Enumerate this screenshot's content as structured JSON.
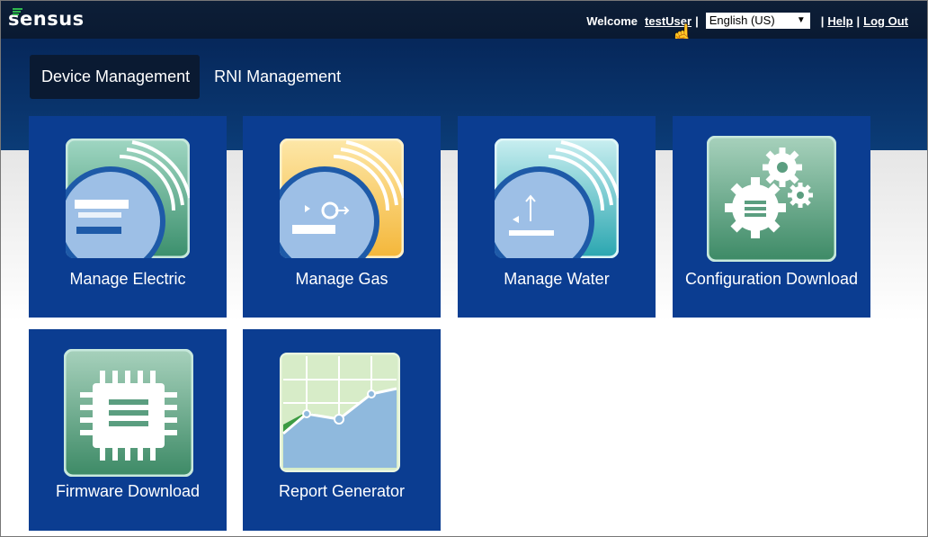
{
  "header": {
    "logo_text": "sensus",
    "welcome_label": "Welcome",
    "username": "testUser",
    "language": "English (US)",
    "help_label": "Help",
    "logout_label": "Log Out"
  },
  "tabs": [
    {
      "label": "Device Management",
      "active": true
    },
    {
      "label": "RNI Management",
      "active": false
    }
  ],
  "tiles": [
    {
      "label": "Manage Electric",
      "icon": "electric-meter-icon"
    },
    {
      "label": "Manage Gas",
      "icon": "gas-meter-icon"
    },
    {
      "label": "Manage Water",
      "icon": "water-meter-icon"
    },
    {
      "label": "Configuration Download",
      "icon": "gears-icon"
    },
    {
      "label": "Firmware Download",
      "icon": "chip-icon"
    },
    {
      "label": "Report Generator",
      "icon": "line-chart-icon"
    }
  ],
  "colors": {
    "tile": "#0b3d91",
    "header": "#0a1a32",
    "band": "#06275a",
    "accent_green": "#2eb84d"
  }
}
